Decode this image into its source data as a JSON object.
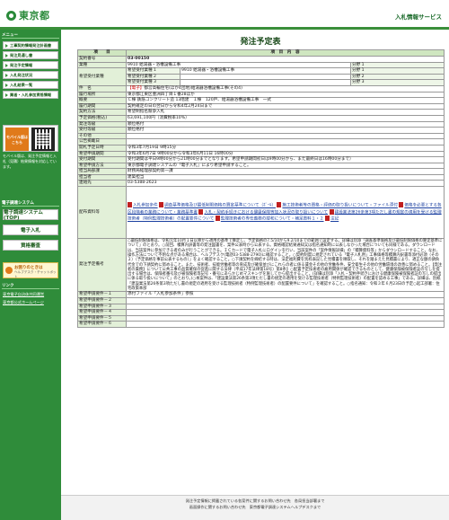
{
  "header": {
    "logo_text": "東京都",
    "right_title": "入札情報サービス"
  },
  "sidebar": {
    "section1": "メニュー",
    "items": [
      "工事契約情報発注計画書",
      "発注見通し書",
      "発注予定情報",
      "入札発注状況",
      "入札結果一覧",
      "業者・入札参加資格情報"
    ],
    "mobile_label": "モバイル版はこちら",
    "mobile_note": "モバイル版は、発注予定情報と入札（見積）結果情報を対応しています。",
    "section2": "電子調達システム",
    "big_items": [
      "電子調達システム(TOP)",
      "電子入札",
      "資格審査"
    ],
    "help_title": "お困りのときは",
    "help_sub": "ヘルプデスク・チャットボット",
    "section3": "リンク",
    "links": [
      "東京電子自治体共同運営",
      "東京都公式ホームページ"
    ]
  },
  "main": {
    "title": "発注予定表",
    "col_item": "項　　目",
    "col_content": "項　目　内　容",
    "rows": {
      "contract_no_label": "契約番号",
      "contract_no": "03-00150",
      "type_label": "業種",
      "type_value": "9910 給湯器・浴槽設備工事",
      "type_rank_label": "分野 1",
      "wish_label": "希望受付業種",
      "wish1_label": "希望受付業種 1",
      "wish1_value": "9910 給湯器・浴槽設備工事",
      "wish1_rank": "分野 1",
      "wish2_label": "希望受付業種 2",
      "wish2_rank": "分野 2",
      "wish3_label": "希望受付業種 3",
      "wish3_rank": "分野 3",
      "name_label": "件　名",
      "name_tag": "【電子】",
      "name_value": "都営高輪住宅(ほか4団地)給湯器浴槽設備工事(その4)",
      "place_label": "履行場所",
      "place_value": "東京都江東区豊洲四丁目１番28ほか",
      "summary_label": "概要",
      "summary_value": "Ｃ棟 鉄筋コンクリート造 13階建　１棟　120戸、給湯器浴槽設備工事　一式",
      "period_label": "履行期間",
      "period_value": "契約確定の日の翌日から令和4年2月24日まで",
      "method_label": "契約方法",
      "method_value": "希望制指名競争入札",
      "price_label": "予定価格(税込)",
      "price_value": "63,691,100円（消費税率10%）",
      "dept_label": "発注等級",
      "dept_value": "順位格付",
      "accept_label": "受付等級",
      "accept_value": "順位格付",
      "other_label": "その他",
      "date_label": "公告掲載日",
      "open_label": "開札予定日時",
      "open_value": "令和3年7月19日 9時15分",
      "apply_label": "希望申請期間",
      "apply_value": "令和3年6月7日 9時00分から令和3年6月11日 16時00分",
      "accept_period_label": "受付期間",
      "accept_period_value": "受付期間は平日9時00分から21時00分までとなります。希望申請期間初日は9時00分から、また最終日は16時00分まで）",
      "proc_label": "希望申請方法",
      "proc_value": "東京都電子調達システムの「電子入札」により希望申請すること。",
      "office_label": "担当局部課",
      "office_value": "財務局経理部契約第一課",
      "person_label": "担当者",
      "person_value": "建築担当",
      "tel_label": "連絡先",
      "tel_value": "03-5388-2623",
      "docs_label": "配布資料等",
      "docs": [
        "入札参加条件",
        "調査基準価格及び最低制限価格の算定基準について（ﾎﾞｰﾙ）",
        "施工技術者等の資格・評価の取り扱いについて・ファイル添付",
        "価格を必要とする各区段階者の業務について・業務基準書",
        "入札・契約手続きにおける健康保険等加入状況の取り扱いについて",
        "建設業法第26条第3項ただし書の規定の適用を受ける監理技術者（特例監理技術者）の配置要件について",
        "監理技術者の専任義務の緩和について・補足資料１・２",
        "注記"
      ],
      "notes_label": "発注予定備考",
      "notes": "○最低制限価格は、令和元年10月１日以降から適用の基準で算定し、予定価格の7.5/10から9.2/10までの範囲で設定する。詳細は別添「調査基準価格及び最低制限価格の算定基準について」のとおり。○前回、積算内訳書等の発注図書を、案件公表時から公表する。資格確認結果通知又は指名通知時に公表しなかった場合についても同様である。ダウンロードは、当該案件に参加できる者のみが行うことができる。ＩＣカードで電子入札にログインを行い、当該案件の「案件情報詳細」の「積算資料等」からダウンロードすること。なお、操作方法について不明な点がある場合は、ヘルプデスク(電話03-5388-2790)に確認すること。○契約制度に規定されている「電子入札用」工事価格等積算内訳書等添付必須（その２）（予定価格を事前公表するもの）」をよく確認すること。○下請契約を締結する時は、法定福利費を別枠表記した見積書を徴取し、それを踏まえた見積書により、適正な額の請負代金での下請契約に努めること。また、技術者、技能労働者等の育成及び確保並びにこれらの者に係る賃金その他の労働条件、安全衛生その他の労働環境の改善に努めること。【発注者の責務】について公共工事の品質確保の促進に関する法律（平成17年法律第18号）第8条】○配置予定技術者の雇用関係が確認できるものとして、健康保険被保険者証の写しを提出する場合は、保険者番号及び被保険者等記号・番号にあらかじめマスキングを施してから提出すること。(詳細は別添「入札・契約手続きにおける健康保険被保険者証の写しの提出に係る取り扱いについて」のとおり。)○本案件は、「建設業法第26条第3項ただし書の規定の適用を受ける監理技術者（特例監理技術者）の配置を認める工事」である。詳細は、別紙「建設業法第26条第3項ただし書の規定の適用を受ける監理技術者（特例監理技術者）の配置要件について」を確認すること。○指名通知：令和３年６月23日の予定○起工部署：住宅政策本部",
      "wish_extra_1_label": "希望申請要件－１",
      "wish_extra_1_value": "添付ファイル「入札参加条件」参照",
      "wish_extra_2_label": "希望申請要件－２",
      "wish_extra_3_label": "希望申請要件－３",
      "wish_extra_4_label": "希望申請要件－４",
      "wish_extra_5_label": "希望申請要件－５",
      "wish_extra_6_label": "希望申請要件－６"
    },
    "back_button": "案件一覧画面へ戻る"
  },
  "footer": {
    "line1": "発注予定情報に掲載されている各案件に関するお問い合わせ先　各局担当部署まで",
    "line2": "画面操作に関するお問い合わせ先　東京都電子調達システムヘルプデスクまで"
  }
}
